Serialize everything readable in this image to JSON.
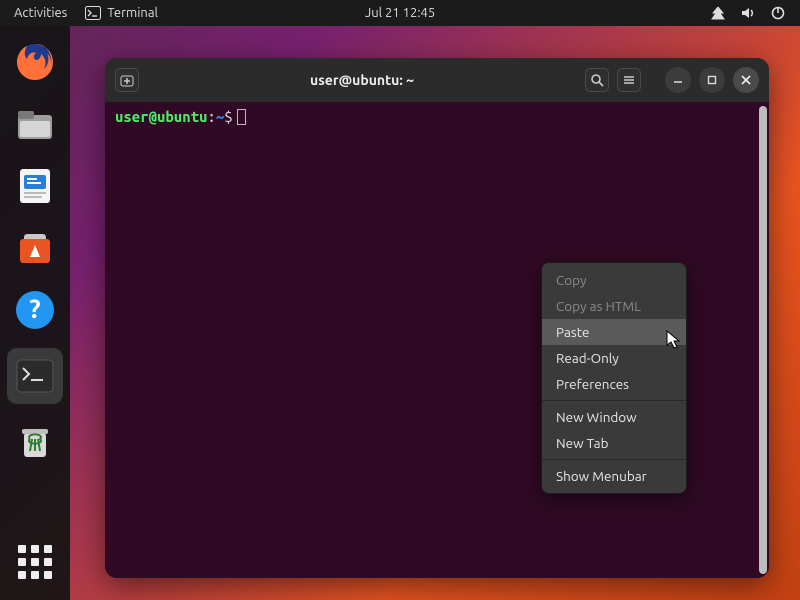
{
  "topbar": {
    "activities": "Activities",
    "app": "Terminal",
    "clock": "Jul 21  12:45"
  },
  "window": {
    "title": "user@ubuntu: ~"
  },
  "prompt": {
    "userhost": "user@ubuntu",
    "colon": ":",
    "path": "~",
    "dollar": "$"
  },
  "context_menu": {
    "copy": "Copy",
    "copy_html": "Copy as HTML",
    "paste": "Paste",
    "read_only": "Read-Only",
    "preferences": "Preferences",
    "new_window": "New Window",
    "new_tab": "New Tab",
    "show_menubar": "Show Menubar"
  }
}
